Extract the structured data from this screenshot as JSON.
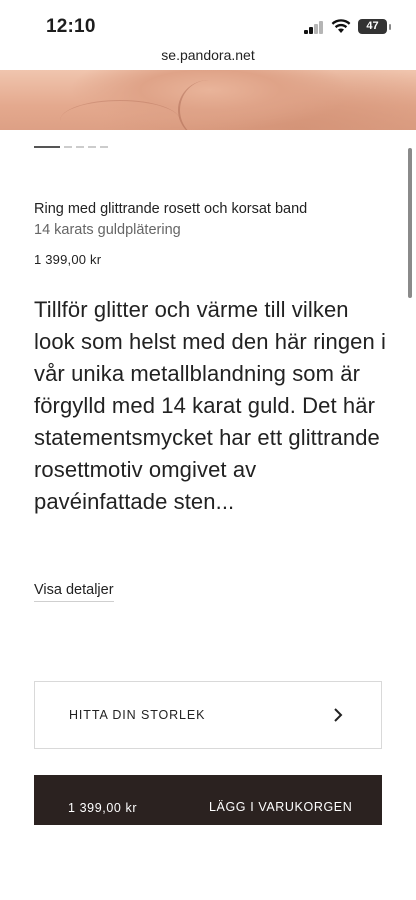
{
  "status_bar": {
    "time": "12:10",
    "battery": "47"
  },
  "browser": {
    "url": "se.pandora.net"
  },
  "product": {
    "title": "Ring med glittrande rosett och korsat band",
    "material": "14 karats guldplätering",
    "price": "1 399,00 kr",
    "description": "Tillför glitter och värme till vilken look som helst med den här ringen i vår unika metallblandning som är förgylld med 14 karat guld. Det här statementsmycket har ett glittrande rosettmotiv omgivet av pavéinfattade sten..."
  },
  "details_link": "Visa detaljer",
  "size_finder": {
    "label": "HITTA DIN STORLEK",
    "icon": "chevron-right-icon"
  },
  "cart": {
    "price": "1 399,00 kr",
    "label": "LÄGG I VARUKORGEN",
    "background": "#2b2220"
  },
  "carousel": {
    "total": 5,
    "active": 1
  }
}
